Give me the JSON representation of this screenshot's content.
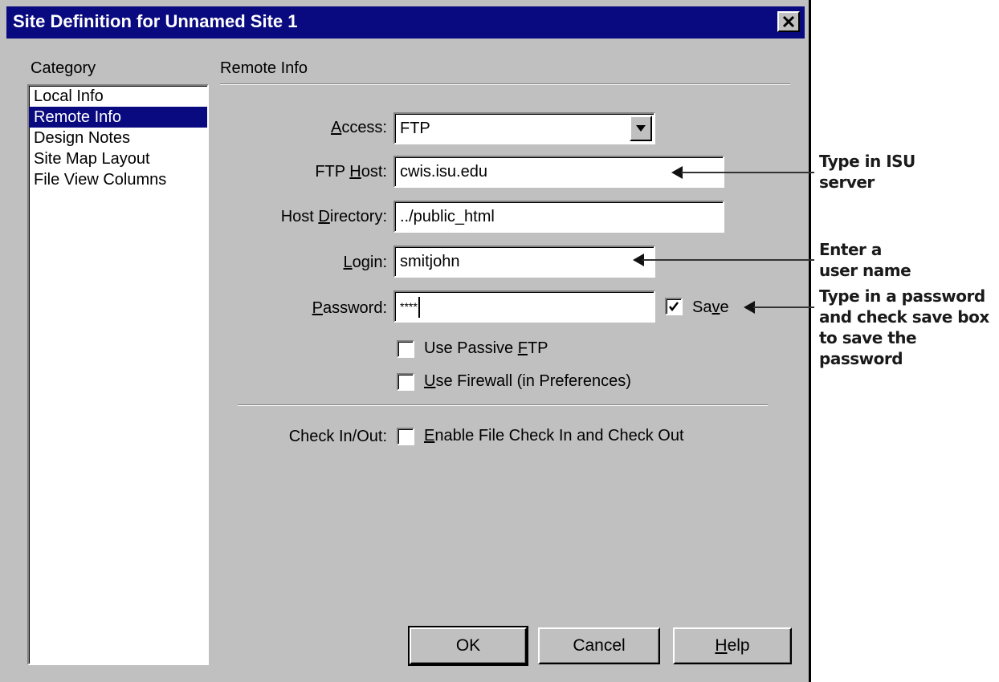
{
  "window": {
    "title": "Site Definition for Unnamed Site 1",
    "close_symbol": "✕"
  },
  "category": {
    "label": "Category",
    "items": [
      {
        "label": "Local Info",
        "selected": false
      },
      {
        "label": "Remote Info",
        "selected": true
      },
      {
        "label": "Design Notes",
        "selected": false
      },
      {
        "label": "Site Map Layout",
        "selected": false
      },
      {
        "label": "File View Columns",
        "selected": false
      }
    ]
  },
  "panel": {
    "title": "Remote Info",
    "access": {
      "label_pre": "",
      "label_key": "A",
      "label_post": "ccess:",
      "value": "FTP"
    },
    "ftp_host": {
      "label_pre": "FTP ",
      "label_key": "H",
      "label_post": "ost:",
      "value": "cwis.isu.edu"
    },
    "host_directory": {
      "label_pre": "Host ",
      "label_key": "D",
      "label_post": "irectory:",
      "value": "../public_html"
    },
    "login": {
      "label_pre": "",
      "label_key": "L",
      "label_post": "ogin:",
      "value": "smitjohn"
    },
    "password": {
      "label_pre": "",
      "label_key": "P",
      "label_post": "assword:",
      "value": "****"
    },
    "save": {
      "label_pre": "Sa",
      "label_key": "v",
      "label_post": "e",
      "checked": true
    },
    "passive_ftp": {
      "label_pre": "Use Passive ",
      "label_key": "F",
      "label_post": "TP",
      "checked": false
    },
    "firewall": {
      "label_pre": "",
      "label_key": "U",
      "label_post": "se Firewall (in Preferences)",
      "checked": false
    },
    "check_in_out": {
      "label": "Check In/Out:",
      "option_pre": "",
      "option_key": "E",
      "option_post": "nable File Check In and Check Out",
      "checked": false
    }
  },
  "buttons": {
    "ok": "OK",
    "cancel": "Cancel",
    "help_key": "H",
    "help_post": "elp"
  },
  "annotations": {
    "ftp_host": [
      "Type in ISU",
      "server"
    ],
    "login": [
      "Enter a",
      "user name"
    ],
    "password": [
      "Type in a password",
      "and check save box",
      "to save the password"
    ]
  },
  "colors": {
    "dialog_bg": "#c0c0c0",
    "titlebar": "#0a0a80",
    "selection": "#0a0a80"
  }
}
